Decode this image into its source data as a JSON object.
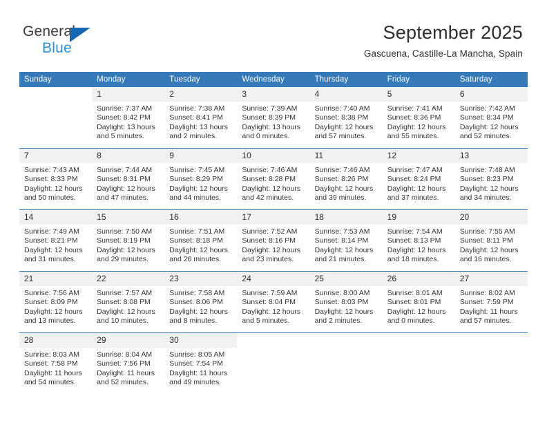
{
  "brand": {
    "name_part1": "General",
    "name_part2": "Blue",
    "triangle_color": "#1668b3",
    "blue_text_color": "#2b8fd6"
  },
  "header": {
    "month_title": "September 2025",
    "location": "Gascuena, Castille-La Mancha, Spain"
  },
  "theme": {
    "header_row_bg": "#3579b8",
    "day_number_bg": "#f1f1f1",
    "week_separator": "#3579b8"
  },
  "weekday_headers": [
    "Sunday",
    "Monday",
    "Tuesday",
    "Wednesday",
    "Thursday",
    "Friday",
    "Saturday"
  ],
  "labels": {
    "sunrise_prefix": "Sunrise:",
    "sunset_prefix": "Sunset:",
    "daylight_prefix": "Daylight:"
  },
  "weeks": [
    [
      {
        "empty": true
      },
      {
        "day": "1",
        "sunrise": "Sunrise: 7:37 AM",
        "sunset": "Sunset: 8:42 PM",
        "daylight_line1": "Daylight: 13 hours",
        "daylight_line2": "and 5 minutes."
      },
      {
        "day": "2",
        "sunrise": "Sunrise: 7:38 AM",
        "sunset": "Sunset: 8:41 PM",
        "daylight_line1": "Daylight: 13 hours",
        "daylight_line2": "and 2 minutes."
      },
      {
        "day": "3",
        "sunrise": "Sunrise: 7:39 AM",
        "sunset": "Sunset: 8:39 PM",
        "daylight_line1": "Daylight: 13 hours",
        "daylight_line2": "and 0 minutes."
      },
      {
        "day": "4",
        "sunrise": "Sunrise: 7:40 AM",
        "sunset": "Sunset: 8:38 PM",
        "daylight_line1": "Daylight: 12 hours",
        "daylight_line2": "and 57 minutes."
      },
      {
        "day": "5",
        "sunrise": "Sunrise: 7:41 AM",
        "sunset": "Sunset: 8:36 PM",
        "daylight_line1": "Daylight: 12 hours",
        "daylight_line2": "and 55 minutes."
      },
      {
        "day": "6",
        "sunrise": "Sunrise: 7:42 AM",
        "sunset": "Sunset: 8:34 PM",
        "daylight_line1": "Daylight: 12 hours",
        "daylight_line2": "and 52 minutes."
      }
    ],
    [
      {
        "day": "7",
        "sunrise": "Sunrise: 7:43 AM",
        "sunset": "Sunset: 8:33 PM",
        "daylight_line1": "Daylight: 12 hours",
        "daylight_line2": "and 50 minutes."
      },
      {
        "day": "8",
        "sunrise": "Sunrise: 7:44 AM",
        "sunset": "Sunset: 8:31 PM",
        "daylight_line1": "Daylight: 12 hours",
        "daylight_line2": "and 47 minutes."
      },
      {
        "day": "9",
        "sunrise": "Sunrise: 7:45 AM",
        "sunset": "Sunset: 8:29 PM",
        "daylight_line1": "Daylight: 12 hours",
        "daylight_line2": "and 44 minutes."
      },
      {
        "day": "10",
        "sunrise": "Sunrise: 7:46 AM",
        "sunset": "Sunset: 8:28 PM",
        "daylight_line1": "Daylight: 12 hours",
        "daylight_line2": "and 42 minutes."
      },
      {
        "day": "11",
        "sunrise": "Sunrise: 7:46 AM",
        "sunset": "Sunset: 8:26 PM",
        "daylight_line1": "Daylight: 12 hours",
        "daylight_line2": "and 39 minutes."
      },
      {
        "day": "12",
        "sunrise": "Sunrise: 7:47 AM",
        "sunset": "Sunset: 8:24 PM",
        "daylight_line1": "Daylight: 12 hours",
        "daylight_line2": "and 37 minutes."
      },
      {
        "day": "13",
        "sunrise": "Sunrise: 7:48 AM",
        "sunset": "Sunset: 8:23 PM",
        "daylight_line1": "Daylight: 12 hours",
        "daylight_line2": "and 34 minutes."
      }
    ],
    [
      {
        "day": "14",
        "sunrise": "Sunrise: 7:49 AM",
        "sunset": "Sunset: 8:21 PM",
        "daylight_line1": "Daylight: 12 hours",
        "daylight_line2": "and 31 minutes."
      },
      {
        "day": "15",
        "sunrise": "Sunrise: 7:50 AM",
        "sunset": "Sunset: 8:19 PM",
        "daylight_line1": "Daylight: 12 hours",
        "daylight_line2": "and 29 minutes."
      },
      {
        "day": "16",
        "sunrise": "Sunrise: 7:51 AM",
        "sunset": "Sunset: 8:18 PM",
        "daylight_line1": "Daylight: 12 hours",
        "daylight_line2": "and 26 minutes."
      },
      {
        "day": "17",
        "sunrise": "Sunrise: 7:52 AM",
        "sunset": "Sunset: 8:16 PM",
        "daylight_line1": "Daylight: 12 hours",
        "daylight_line2": "and 23 minutes."
      },
      {
        "day": "18",
        "sunrise": "Sunrise: 7:53 AM",
        "sunset": "Sunset: 8:14 PM",
        "daylight_line1": "Daylight: 12 hours",
        "daylight_line2": "and 21 minutes."
      },
      {
        "day": "19",
        "sunrise": "Sunrise: 7:54 AM",
        "sunset": "Sunset: 8:13 PM",
        "daylight_line1": "Daylight: 12 hours",
        "daylight_line2": "and 18 minutes."
      },
      {
        "day": "20",
        "sunrise": "Sunrise: 7:55 AM",
        "sunset": "Sunset: 8:11 PM",
        "daylight_line1": "Daylight: 12 hours",
        "daylight_line2": "and 16 minutes."
      }
    ],
    [
      {
        "day": "21",
        "sunrise": "Sunrise: 7:56 AM",
        "sunset": "Sunset: 8:09 PM",
        "daylight_line1": "Daylight: 12 hours",
        "daylight_line2": "and 13 minutes."
      },
      {
        "day": "22",
        "sunrise": "Sunrise: 7:57 AM",
        "sunset": "Sunset: 8:08 PM",
        "daylight_line1": "Daylight: 12 hours",
        "daylight_line2": "and 10 minutes."
      },
      {
        "day": "23",
        "sunrise": "Sunrise: 7:58 AM",
        "sunset": "Sunset: 8:06 PM",
        "daylight_line1": "Daylight: 12 hours",
        "daylight_line2": "and 8 minutes."
      },
      {
        "day": "24",
        "sunrise": "Sunrise: 7:59 AM",
        "sunset": "Sunset: 8:04 PM",
        "daylight_line1": "Daylight: 12 hours",
        "daylight_line2": "and 5 minutes."
      },
      {
        "day": "25",
        "sunrise": "Sunrise: 8:00 AM",
        "sunset": "Sunset: 8:03 PM",
        "daylight_line1": "Daylight: 12 hours",
        "daylight_line2": "and 2 minutes."
      },
      {
        "day": "26",
        "sunrise": "Sunrise: 8:01 AM",
        "sunset": "Sunset: 8:01 PM",
        "daylight_line1": "Daylight: 12 hours",
        "daylight_line2": "and 0 minutes."
      },
      {
        "day": "27",
        "sunrise": "Sunrise: 8:02 AM",
        "sunset": "Sunset: 7:59 PM",
        "daylight_line1": "Daylight: 11 hours",
        "daylight_line2": "and 57 minutes."
      }
    ],
    [
      {
        "day": "28",
        "sunrise": "Sunrise: 8:03 AM",
        "sunset": "Sunset: 7:58 PM",
        "daylight_line1": "Daylight: 11 hours",
        "daylight_line2": "and 54 minutes."
      },
      {
        "day": "29",
        "sunrise": "Sunrise: 8:04 AM",
        "sunset": "Sunset: 7:56 PM",
        "daylight_line1": "Daylight: 11 hours",
        "daylight_line2": "and 52 minutes."
      },
      {
        "day": "30",
        "sunrise": "Sunrise: 8:05 AM",
        "sunset": "Sunset: 7:54 PM",
        "daylight_line1": "Daylight: 11 hours",
        "daylight_line2": "and 49 minutes."
      },
      {
        "empty": true
      },
      {
        "empty": true
      },
      {
        "empty": true
      },
      {
        "empty": true
      }
    ]
  ]
}
